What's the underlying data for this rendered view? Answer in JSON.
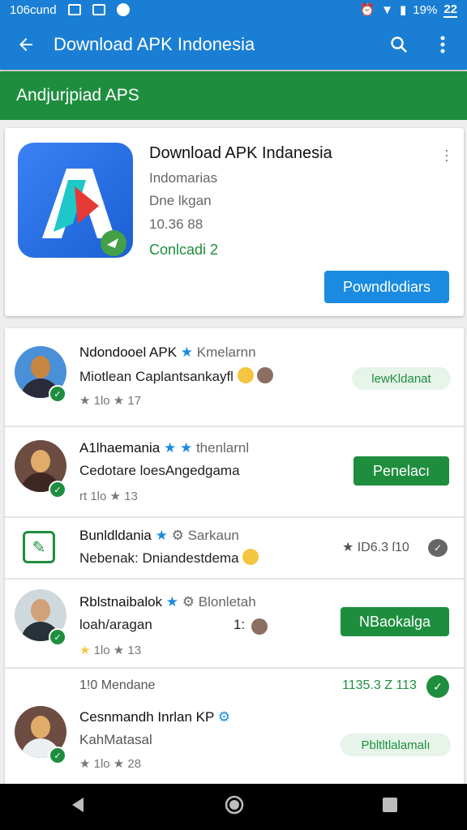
{
  "status_bar": {
    "time": "106cund",
    "battery": "19%",
    "battery_label": "22"
  },
  "app_bar": {
    "title": "Download APK Indonesia",
    "back_icon": "arrow-left-icon",
    "search_icon": "search-icon",
    "menu_icon": "more-vert-icon"
  },
  "section": {
    "title": "Andjurjpiad APS"
  },
  "featured": {
    "title": "Download APK Indanesia",
    "developer": "Indomarias",
    "category": "Dne lkgan",
    "size": "10.36 88",
    "downloads": "Conlcadi 2",
    "button_label": "Powndlodiars"
  },
  "list": [
    {
      "title": "Ndondooel APK",
      "title_extra": "Kmelarnn",
      "subtitle": "Miotlean Caplantsankayfl",
      "rating": "★ 1lo ★ 17",
      "action": "lewKldanat"
    },
    {
      "title": "A1lhaemania",
      "title_extra": "thenlarnl",
      "subtitle": "Cedotare loesAngedgama",
      "rating": "rt 1lo ★ 13",
      "action": "Penelacı"
    },
    {
      "title": "Bunldldania",
      "title_extra": "Sarkaun",
      "subtitle": "Nebenak: Dniandestdema",
      "rating": "★ ID6.3 ſ10"
    },
    {
      "title": "Rblstnaibalok",
      "title_extra": "Blonletah",
      "subtitle": "loah/aragan",
      "subtitle_extra": "1:",
      "rating": "1lo ★ 13",
      "action": "NBaokalga"
    },
    {
      "header_left": "1!0 Mendane",
      "header_right": "1135.3 Z 113",
      "title": "Cesnmandh Inrlan",
      "title_extra": "KP",
      "subtitle": "KahMatasal",
      "rating": "★ 1lo ★ 28",
      "action": "Pbltltlalamalı"
    }
  ],
  "colors": {
    "primary": "#1a7fd4",
    "green": "#1e8e3e",
    "light_green": "#e6f4ea",
    "button_blue": "#1a8be0"
  }
}
